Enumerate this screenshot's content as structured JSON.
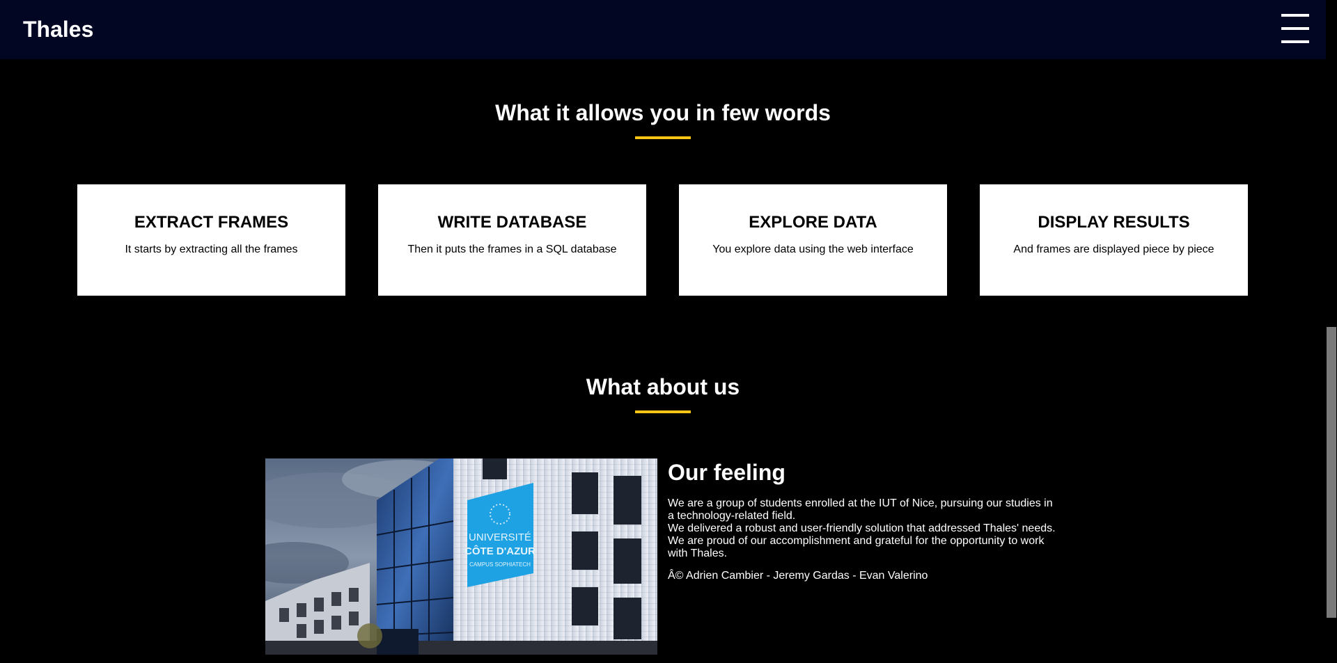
{
  "header": {
    "brand": "Thales",
    "menu_icon": "hamburger-menu-icon"
  },
  "features": {
    "title": "What it allows you in few words",
    "cards": [
      {
        "title": "EXTRACT FRAMES",
        "text": "It starts by extracting all the frames"
      },
      {
        "title": "WRITE DATABASE",
        "text": "Then it puts the frames in a SQL database"
      },
      {
        "title": "EXPLORE DATA",
        "text": "You explore data using the web interface"
      },
      {
        "title": "DISPLAY RESULTS",
        "text": "And frames are displayed piece by piece"
      }
    ]
  },
  "about": {
    "title": "What about us",
    "heading": "Our feeling",
    "lines": [
      "We are a group of students enrolled at the IUT of Nice, pursuing our studies in a technology-related field.",
      "We delivered a robust and user-friendly solution that addressed Thales' needs.",
      "We are proud of our accomplishment and grateful for the opportunity to work with Thales."
    ],
    "credits": "Â© Adrien Cambier - Jeremy Gardas - Evan Valerino",
    "image_sign": {
      "line1": "UNIVERSITÉ",
      "line2": "CÔTE D'AZUR",
      "line3": "CAMPUS SOPHIATECH"
    }
  },
  "colors": {
    "header_bg": "#020623",
    "page_bg": "#000000",
    "accent": "#f6c515",
    "card_bg": "#ffffff"
  }
}
